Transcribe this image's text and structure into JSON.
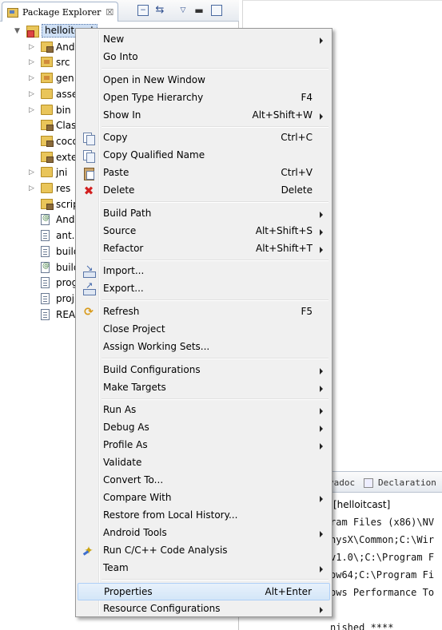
{
  "explorer": {
    "tab_title": "Package Explorer",
    "close_glyph": "☒",
    "tree": [
      {
        "label": "helloitcast",
        "icon": "project-icon",
        "twisty": "▼"
      },
      {
        "label": "And",
        "icon": "android-library-icon",
        "twisty": "▷"
      },
      {
        "label": "src",
        "icon": "source-folder-icon",
        "twisty": "▷"
      },
      {
        "label": "gen",
        "icon": "source-folder-icon",
        "twisty": "▷"
      },
      {
        "label": "asse",
        "icon": "folder-icon",
        "twisty": "▷"
      },
      {
        "label": "bin",
        "icon": "folder-icon",
        "twisty": "▷"
      },
      {
        "label": "Clas",
        "icon": "package-folder-icon",
        "twisty": ""
      },
      {
        "label": "coco",
        "icon": "package-folder-icon",
        "twisty": ""
      },
      {
        "label": "exte",
        "icon": "package-folder-icon",
        "twisty": ""
      },
      {
        "label": "jni",
        "icon": "folder-icon",
        "twisty": "▷"
      },
      {
        "label": "res",
        "icon": "folder-icon",
        "twisty": "▷"
      },
      {
        "label": "scrip",
        "icon": "package-folder-icon",
        "twisty": ""
      },
      {
        "label": "And",
        "icon": "xml-file-icon",
        "twisty": ""
      },
      {
        "label": "ant.p",
        "icon": "file-icon",
        "twisty": ""
      },
      {
        "label": "build",
        "icon": "file-icon",
        "twisty": ""
      },
      {
        "label": "build",
        "icon": "xml-file-icon",
        "twisty": ""
      },
      {
        "label": "prog",
        "icon": "file-icon",
        "twisty": ""
      },
      {
        "label": "proj",
        "icon": "file-icon",
        "twisty": ""
      },
      {
        "label": "REA",
        "icon": "file-icon",
        "twisty": ""
      }
    ]
  },
  "console": {
    "tab_javadoc": "vadoc",
    "tab_declaration": "Declaration",
    "title": "[helloitcast]",
    "lines": [
      "ram Files (x86)\\NV",
      "hysX\\Common;C:\\Wir",
      "v1.0\\;C:\\Program F",
      "ow64;C:\\Program Fi",
      "ows Performance To",
      "",
      "nished ****"
    ]
  },
  "menu": {
    "items": [
      {
        "label": "New",
        "shortcut": "",
        "submenu": true
      },
      {
        "label": "Go Into",
        "shortcut": "",
        "submenu": false
      },
      {
        "sep": true
      },
      {
        "label": "Open in New Window",
        "shortcut": "",
        "submenu": false
      },
      {
        "label": "Open Type Hierarchy",
        "shortcut": "F4",
        "submenu": false
      },
      {
        "label": "Show In",
        "shortcut": "Alt+Shift+W",
        "submenu": true
      },
      {
        "sep": true
      },
      {
        "label": "Copy",
        "shortcut": "Ctrl+C",
        "submenu": false,
        "icon": "copy-icon"
      },
      {
        "label": "Copy Qualified Name",
        "shortcut": "",
        "submenu": false,
        "icon": "copy-icon"
      },
      {
        "label": "Paste",
        "shortcut": "Ctrl+V",
        "submenu": false,
        "icon": "paste-icon"
      },
      {
        "label": "Delete",
        "shortcut": "Delete",
        "submenu": false,
        "icon": "delete-icon"
      },
      {
        "sep": true
      },
      {
        "label": "Build Path",
        "shortcut": "",
        "submenu": true
      },
      {
        "label": "Source",
        "shortcut": "Alt+Shift+S",
        "submenu": true
      },
      {
        "label": "Refactor",
        "shortcut": "Alt+Shift+T",
        "submenu": true
      },
      {
        "sep": true
      },
      {
        "label": "Import...",
        "shortcut": "",
        "submenu": false,
        "icon": "import-icon"
      },
      {
        "label": "Export...",
        "shortcut": "",
        "submenu": false,
        "icon": "export-icon"
      },
      {
        "sep": true
      },
      {
        "label": "Refresh",
        "shortcut": "F5",
        "submenu": false,
        "icon": "refresh-icon"
      },
      {
        "label": "Close Project",
        "shortcut": "",
        "submenu": false
      },
      {
        "label": "Assign Working Sets...",
        "shortcut": "",
        "submenu": false
      },
      {
        "sep": true
      },
      {
        "label": "Build Configurations",
        "shortcut": "",
        "submenu": true
      },
      {
        "label": "Make Targets",
        "shortcut": "",
        "submenu": true
      },
      {
        "sep": true
      },
      {
        "label": "Run As",
        "shortcut": "",
        "submenu": true
      },
      {
        "label": "Debug As",
        "shortcut": "",
        "submenu": true
      },
      {
        "label": "Profile As",
        "shortcut": "",
        "submenu": true
      },
      {
        "label": "Validate",
        "shortcut": "",
        "submenu": false
      },
      {
        "label": "Convert To...",
        "shortcut": "",
        "submenu": false
      },
      {
        "label": "Compare With",
        "shortcut": "",
        "submenu": true
      },
      {
        "label": "Restore from Local History...",
        "shortcut": "",
        "submenu": false
      },
      {
        "label": "Android Tools",
        "shortcut": "",
        "submenu": true
      },
      {
        "label": "Run C/C++ Code Analysis",
        "shortcut": "",
        "submenu": false,
        "icon": "code-analysis-icon"
      },
      {
        "label": "Team",
        "shortcut": "",
        "submenu": true
      },
      {
        "sep": true
      },
      {
        "label": "Properties",
        "shortcut": "Alt+Enter",
        "submenu": false,
        "selected": true
      },
      {
        "label": "Resource Configurations",
        "shortcut": "",
        "submenu": true
      }
    ]
  }
}
